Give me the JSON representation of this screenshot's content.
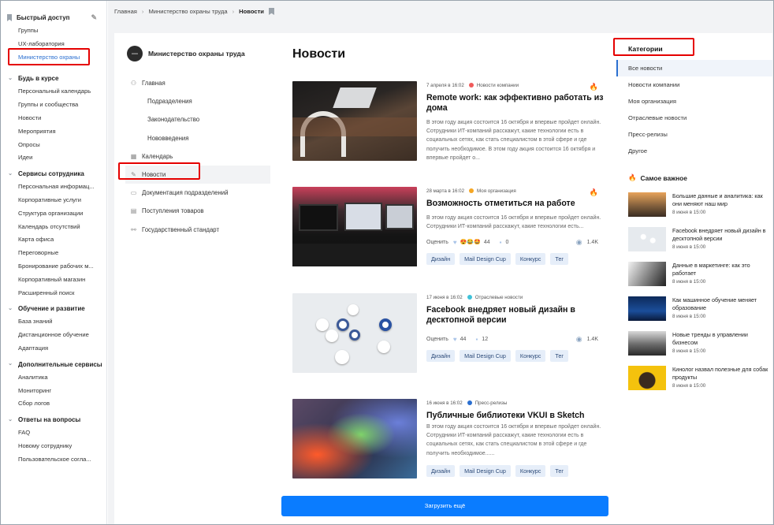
{
  "sidebar": {
    "quick": {
      "title": "Быстрый доступ",
      "items": [
        "Группы",
        "UX-лаборатория",
        "Министерство охраны"
      ]
    },
    "sections": [
      {
        "title": "Будь в курсе",
        "items": [
          "Персональный календарь",
          "Группы и сообщества",
          "Новости",
          "Мероприятия",
          "Опросы",
          "Идеи"
        ]
      },
      {
        "title": "Сервисы сотрудника",
        "items": [
          "Персональная информац...",
          "Корпоративные услуги",
          "Структура организации",
          "Календарь отсутствий",
          "Карта офиса",
          "Переговорные",
          "Бронирование рабочих м...",
          "Корпоративный магазин",
          "Расширенный поиск"
        ]
      },
      {
        "title": "Обучение и развитие",
        "items": [
          "База знаний",
          "Дистанционное обучение",
          "Адаптация"
        ]
      },
      {
        "title": "Дополнительные сервисы",
        "items": [
          "Аналитика",
          "Мониторинг",
          "Сбор логов"
        ]
      },
      {
        "title": "Ответы на вопросы",
        "items": [
          "FAQ",
          "Новому сотруднику",
          "Пользовательское согла..."
        ]
      }
    ]
  },
  "breadcrumb": {
    "home": "Главная",
    "org": "Министерство охраны труда",
    "current": "Новости"
  },
  "org": {
    "logo": "AAAA",
    "name": "Министерство охраны труда"
  },
  "nav": {
    "home": "Главная",
    "sub": [
      "Подразделения",
      "Законодательство",
      "Нововведения"
    ],
    "items": [
      "Календарь",
      "Новости",
      "Документация подразделений",
      "Поступления товаров",
      "Государственный стандарт"
    ]
  },
  "page_title": "Новости",
  "articles": [
    {
      "date": "7 апреля в 16:02",
      "category": "Новости компании",
      "cat_color": "#f05a5a",
      "title": "Remote work: как эффективно работать из дома",
      "text": "В этом году акция состоится 16 октября и впервые пройдет онлайн. Сотрудники ИТ-компаний расскажут, какие технологии есть в социальных сетях, как стать специалистом в этой сфере и где получить необходимое. В этом году акция состоится 16 октября и впервые пройдет о...",
      "hot": true,
      "stats": null,
      "tags": []
    },
    {
      "date": "28 марта в 16:02",
      "category": "Моя организация",
      "cat_color": "#f5a623",
      "title": "Возможность отметиться на работе",
      "text": "В этом году акция состоится 16 октября и впервые пройдет онлайн. Сотрудники ИТ-компаний расскажут, какие технологии есть...",
      "hot": true,
      "stats": {
        "rate": "Оценить",
        "reactions": "😍😂🤩",
        "likes": "44",
        "comments": "0",
        "views": "1.4K"
      },
      "tags": [
        "Дизайн",
        "Mail Design Cup",
        "Конкурс",
        "Тег"
      ]
    },
    {
      "date": "17 июня в 16:02",
      "category": "Отраслевые новости",
      "cat_color": "#3fc2d9",
      "title": "Facebook внедряет новый дизайн в десктопной версии",
      "text": "В этом году акция состоится 16 октября и впервые пройдет онлайн. Сотрудники ИТ-компаний расскажут, какие технологии есть...",
      "hot": false,
      "stats": {
        "rate": "Оценить",
        "reactions": "",
        "likes": "44",
        "comments": "12",
        "views": "1.4K"
      },
      "tags": [
        "Дизайн",
        "Mail Design Cup",
        "Конкурс",
        "Тег"
      ]
    },
    {
      "date": "16 июня в 16:02",
      "category": "Пресс-релизы",
      "cat_color": "#2a6fd0",
      "title": "Публичные библиотеки VKUI в Sketch",
      "text": "В этом году акция состоится 16 октября и впервые пройдет онлайн. Сотрудники ИТ-компаний расскажут, какие технологии есть в социальных сетях, как стать специалистом в этой сфере и где получить необходимое......",
      "hot": false,
      "stats": null,
      "tags": [
        "Дизайн",
        "Mail Design Cup",
        "Конкурс",
        "Тег"
      ]
    }
  ],
  "load_more": "Загрузить ещё",
  "categories": {
    "title": "Категории",
    "items": [
      "Все новости",
      "Новости компании",
      "Моя организация",
      "Отраслевые новости",
      "Пресс-релизы",
      "Другое"
    ]
  },
  "important": {
    "title": "Самое важное",
    "items": [
      {
        "title": "Большие данные и аналитика: как они меняют наш мир",
        "date": "8 июня в 15:00"
      },
      {
        "title": "Facebook внедряет новый дизайн в десктопной версии",
        "date": "8 июня в 15:00"
      },
      {
        "title": "Данные в маркетинге: как это работает",
        "date": "8 июня в 15:00"
      },
      {
        "title": "Как машинное обучение меняет образование",
        "date": "8 июня в 15:00"
      },
      {
        "title": "Новые тренды в управлении бизнесом",
        "date": "8 июня в 15:00"
      },
      {
        "title": "Кинолог назвал полезные для собак продукты",
        "date": "8 июня в 15:00"
      }
    ]
  }
}
